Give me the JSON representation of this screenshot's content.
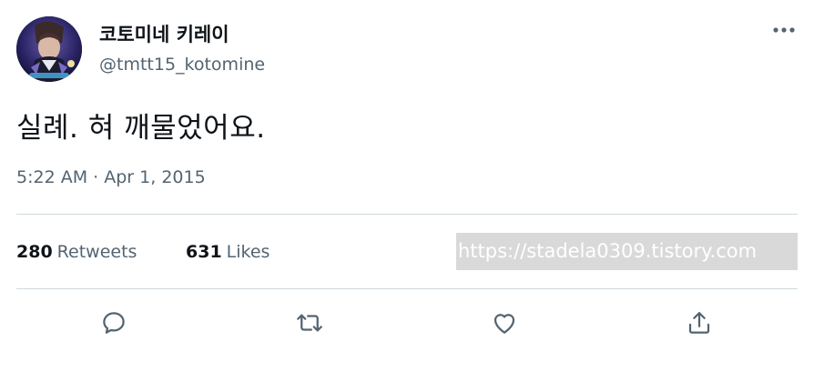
{
  "author": {
    "display_name": "코토미네 키레이",
    "handle": "@tmtt15_kotomine",
    "avatar_icon": "avatar-image"
  },
  "tweet": {
    "text": "실례. 혀 깨물었어요.",
    "time": "5:22 AM",
    "separator": "·",
    "date": "Apr 1, 2015"
  },
  "stats": {
    "retweets_count": "280",
    "retweets_label": "Retweets",
    "likes_count": "631",
    "likes_label": "Likes"
  },
  "watermark": {
    "text": "https://stadela0309.tistory.com"
  },
  "actions": [
    {
      "name": "reply",
      "icon": "reply-icon"
    },
    {
      "name": "retweet",
      "icon": "retweet-icon"
    },
    {
      "name": "like",
      "icon": "heart-icon"
    },
    {
      "name": "share",
      "icon": "share-icon"
    }
  ],
  "colors": {
    "primary_text": "#0f1419",
    "secondary_text": "#536471",
    "divider": "#cfd9de",
    "watermark_bg": "#d9d9d9"
  }
}
